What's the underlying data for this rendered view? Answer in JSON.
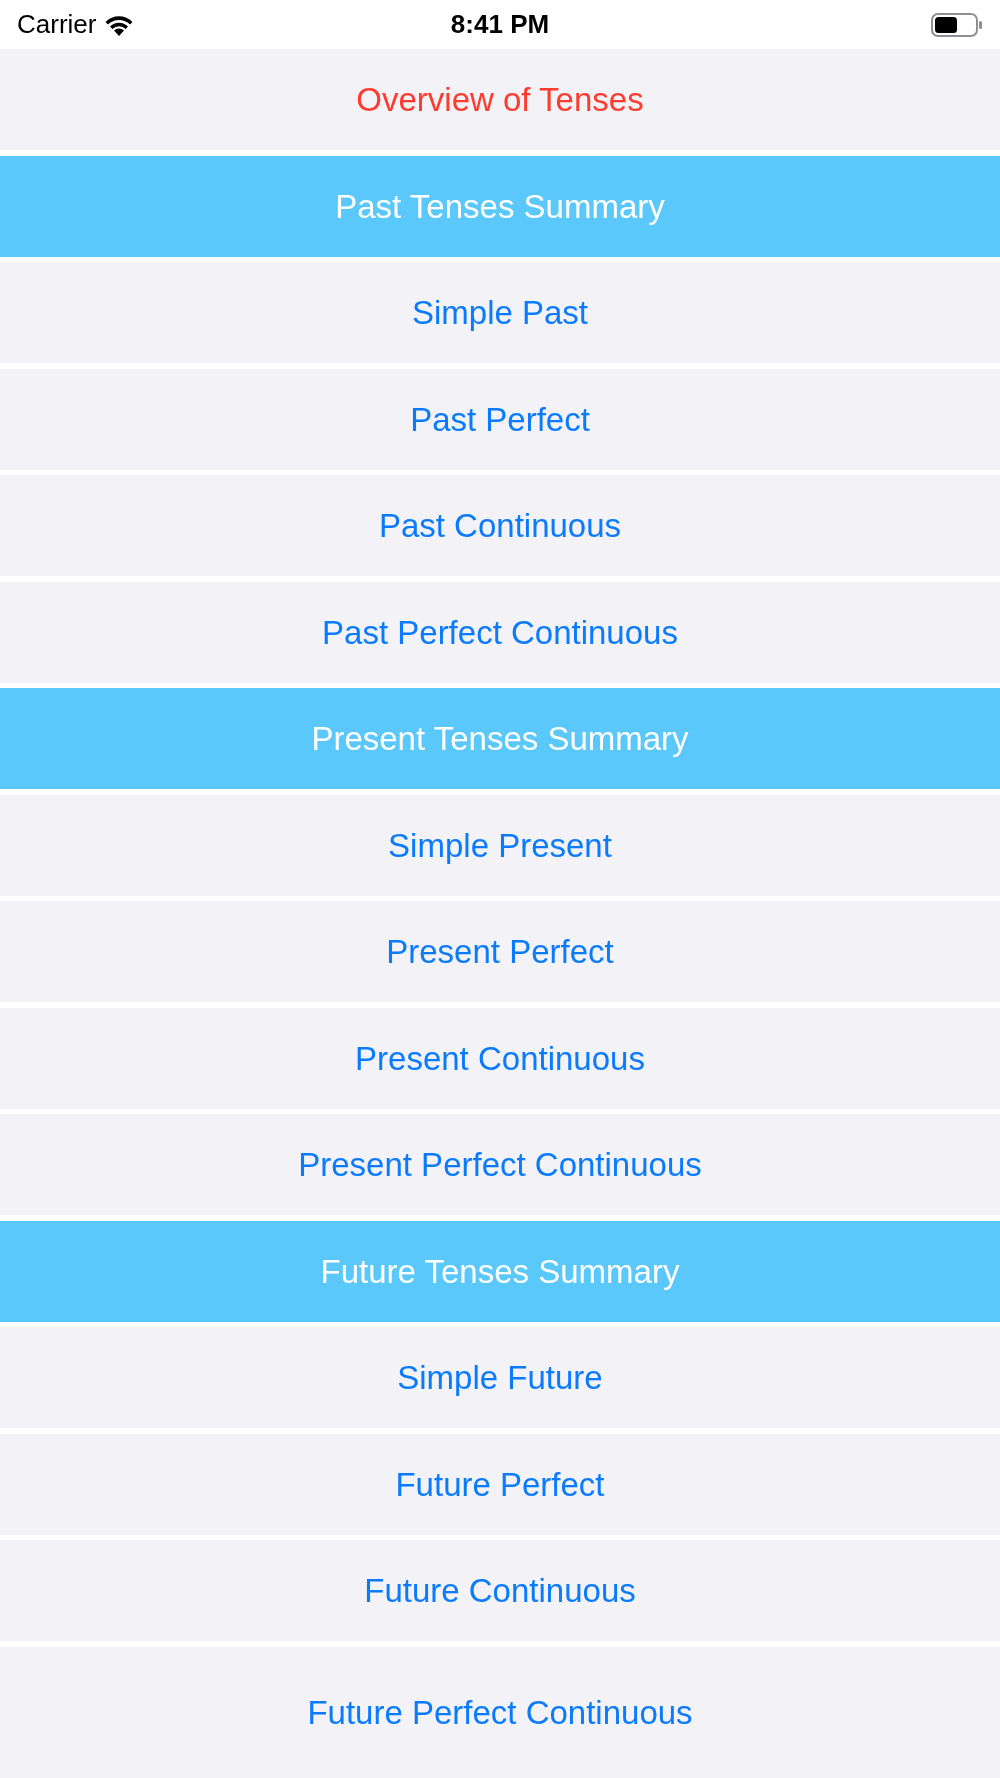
{
  "status_bar": {
    "carrier": "Carrier",
    "time": "8:41 PM"
  },
  "rows": [
    {
      "kind": "title",
      "label": "Overview of Tenses"
    },
    {
      "kind": "section",
      "label": "Past Tenses Summary"
    },
    {
      "kind": "item",
      "label": "Simple Past"
    },
    {
      "kind": "item",
      "label": "Past Perfect"
    },
    {
      "kind": "item",
      "label": "Past Continuous"
    },
    {
      "kind": "item",
      "label": "Past Perfect Continuous"
    },
    {
      "kind": "section",
      "label": "Present Tenses Summary"
    },
    {
      "kind": "item",
      "label": "Simple Present"
    },
    {
      "kind": "item",
      "label": "Present Perfect"
    },
    {
      "kind": "item",
      "label": "Present Continuous"
    },
    {
      "kind": "item",
      "label": "Present Perfect Continuous"
    },
    {
      "kind": "section",
      "label": "Future Tenses Summary"
    },
    {
      "kind": "item",
      "label": "Simple Future"
    },
    {
      "kind": "item",
      "label": "Future Perfect"
    },
    {
      "kind": "item",
      "label": "Future Continuous"
    },
    {
      "kind": "item",
      "label": "Future Perfect Continuous"
    }
  ]
}
